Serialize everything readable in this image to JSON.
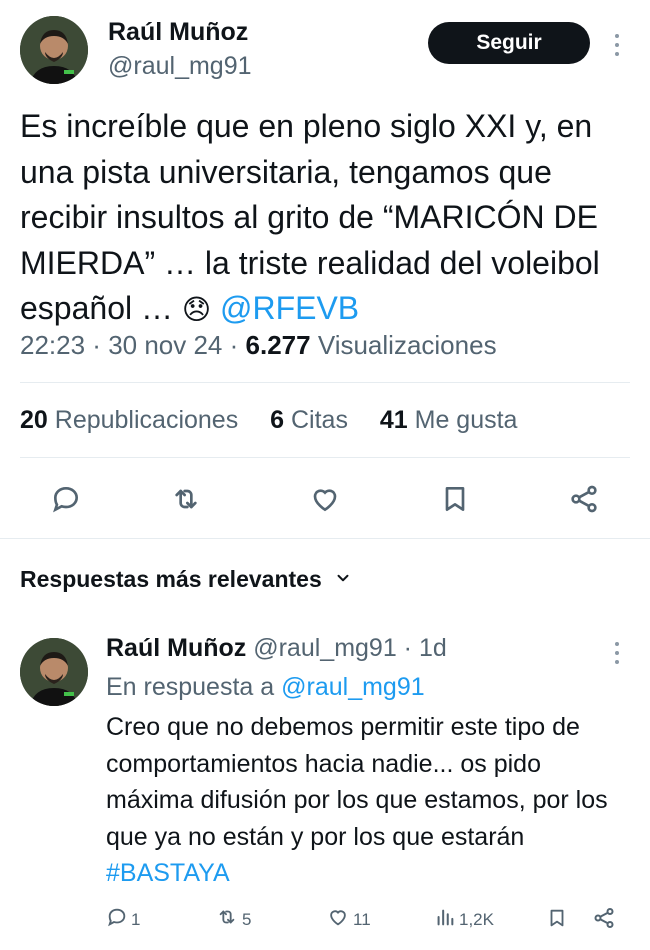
{
  "tweet": {
    "author_name": "Raúl Muñoz",
    "author_handle": "@raul_mg91",
    "follow_label": "Seguir",
    "text_main": "Es increíble que en pleno siglo XXI y, en una pista universitaria, tengamos que recibir insultos al grito de “MARICÓN DE MIERDA” … la triste realidad del voleibol español … ",
    "emoji": "😞",
    "mention": "@RFEVB",
    "time": "22:23",
    "date": "30 nov 24",
    "views_count": "6.277",
    "views_label": "Visualizaciones",
    "retweets_count": "20",
    "retweets_label": "Republicaciones",
    "quotes_count": "6",
    "quotes_label": "Citas",
    "likes_count": "41",
    "likes_label": "Me gusta"
  },
  "replies_section": {
    "sort_label": "Respuestas más relevantes"
  },
  "reply": {
    "author_name": "Raúl Muñoz",
    "author_handle": "@raul_mg91",
    "time_ago": "1d",
    "in_reply_prefix": "En respuesta a",
    "in_reply_handle": "@raul_mg91",
    "text_main": "Creo que no debemos permitir este tipo de comportamientos hacia nadie... os pido máxima difusión por los que estamos, por los que ya no están y por los que estarán ",
    "hashtag": "#BASTAYA",
    "reply_count": "1",
    "retweet_count": "5",
    "like_count": "11",
    "views_count": "1,2K"
  },
  "icons": [
    "reply-icon",
    "retweet-icon",
    "like-icon",
    "bookmark-icon",
    "share-icon",
    "views-icon",
    "more-icon",
    "chevron-down-icon"
  ],
  "colors": {
    "accent": "#1d9bf0",
    "text": "#0f1419",
    "muted": "#536471",
    "button": "#0f1419"
  }
}
